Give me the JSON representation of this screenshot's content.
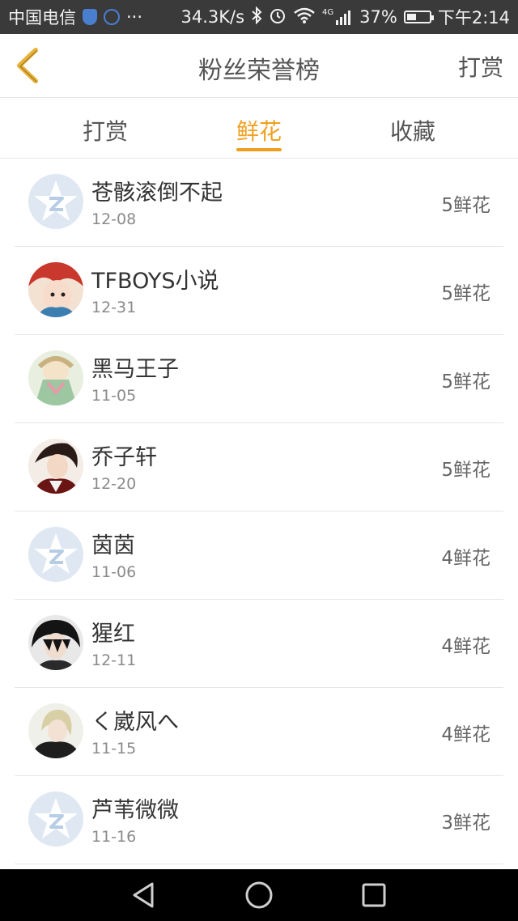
{
  "status_bar": {
    "carrier": "中国电信",
    "more": "···",
    "speed": "34.3K/s",
    "network": "4G",
    "battery": "37%",
    "time": "下午2:14"
  },
  "header": {
    "title": "粉丝荣誉榜",
    "action": "打赏"
  },
  "tabs": [
    {
      "label": "打赏",
      "active": false
    },
    {
      "label": "鲜花",
      "active": true
    },
    {
      "label": "收藏",
      "active": false
    }
  ],
  "colors": {
    "accent": "#f0a020",
    "back_icon": "#e8b23a"
  },
  "fans": [
    {
      "name": "苍骸滚倒不起",
      "date": "12-08",
      "amount": "5鲜花",
      "avatar": "default"
    },
    {
      "name": "TFBOYS小说",
      "date": "12-31",
      "amount": "5鲜花",
      "avatar": "photo"
    },
    {
      "name": "黑马王子",
      "date": "11-05",
      "amount": "5鲜花",
      "avatar": "photo"
    },
    {
      "name": "乔子轩",
      "date": "12-20",
      "amount": "5鲜花",
      "avatar": "photo"
    },
    {
      "name": "茵茵",
      "date": "11-06",
      "amount": "4鲜花",
      "avatar": "default"
    },
    {
      "name": "猩红",
      "date": "12-11",
      "amount": "4鲜花",
      "avatar": "photo"
    },
    {
      "name": "く崴风へ",
      "date": "11-15",
      "amount": "4鲜花",
      "avatar": "photo"
    },
    {
      "name": "芦苇微微",
      "date": "11-16",
      "amount": "3鲜花",
      "avatar": "default"
    }
  ],
  "icons": {
    "back": "chevron-left-icon",
    "nav_back": "triangle-back-icon",
    "nav_home": "circle-home-icon",
    "nav_recent": "square-recent-icon"
  }
}
